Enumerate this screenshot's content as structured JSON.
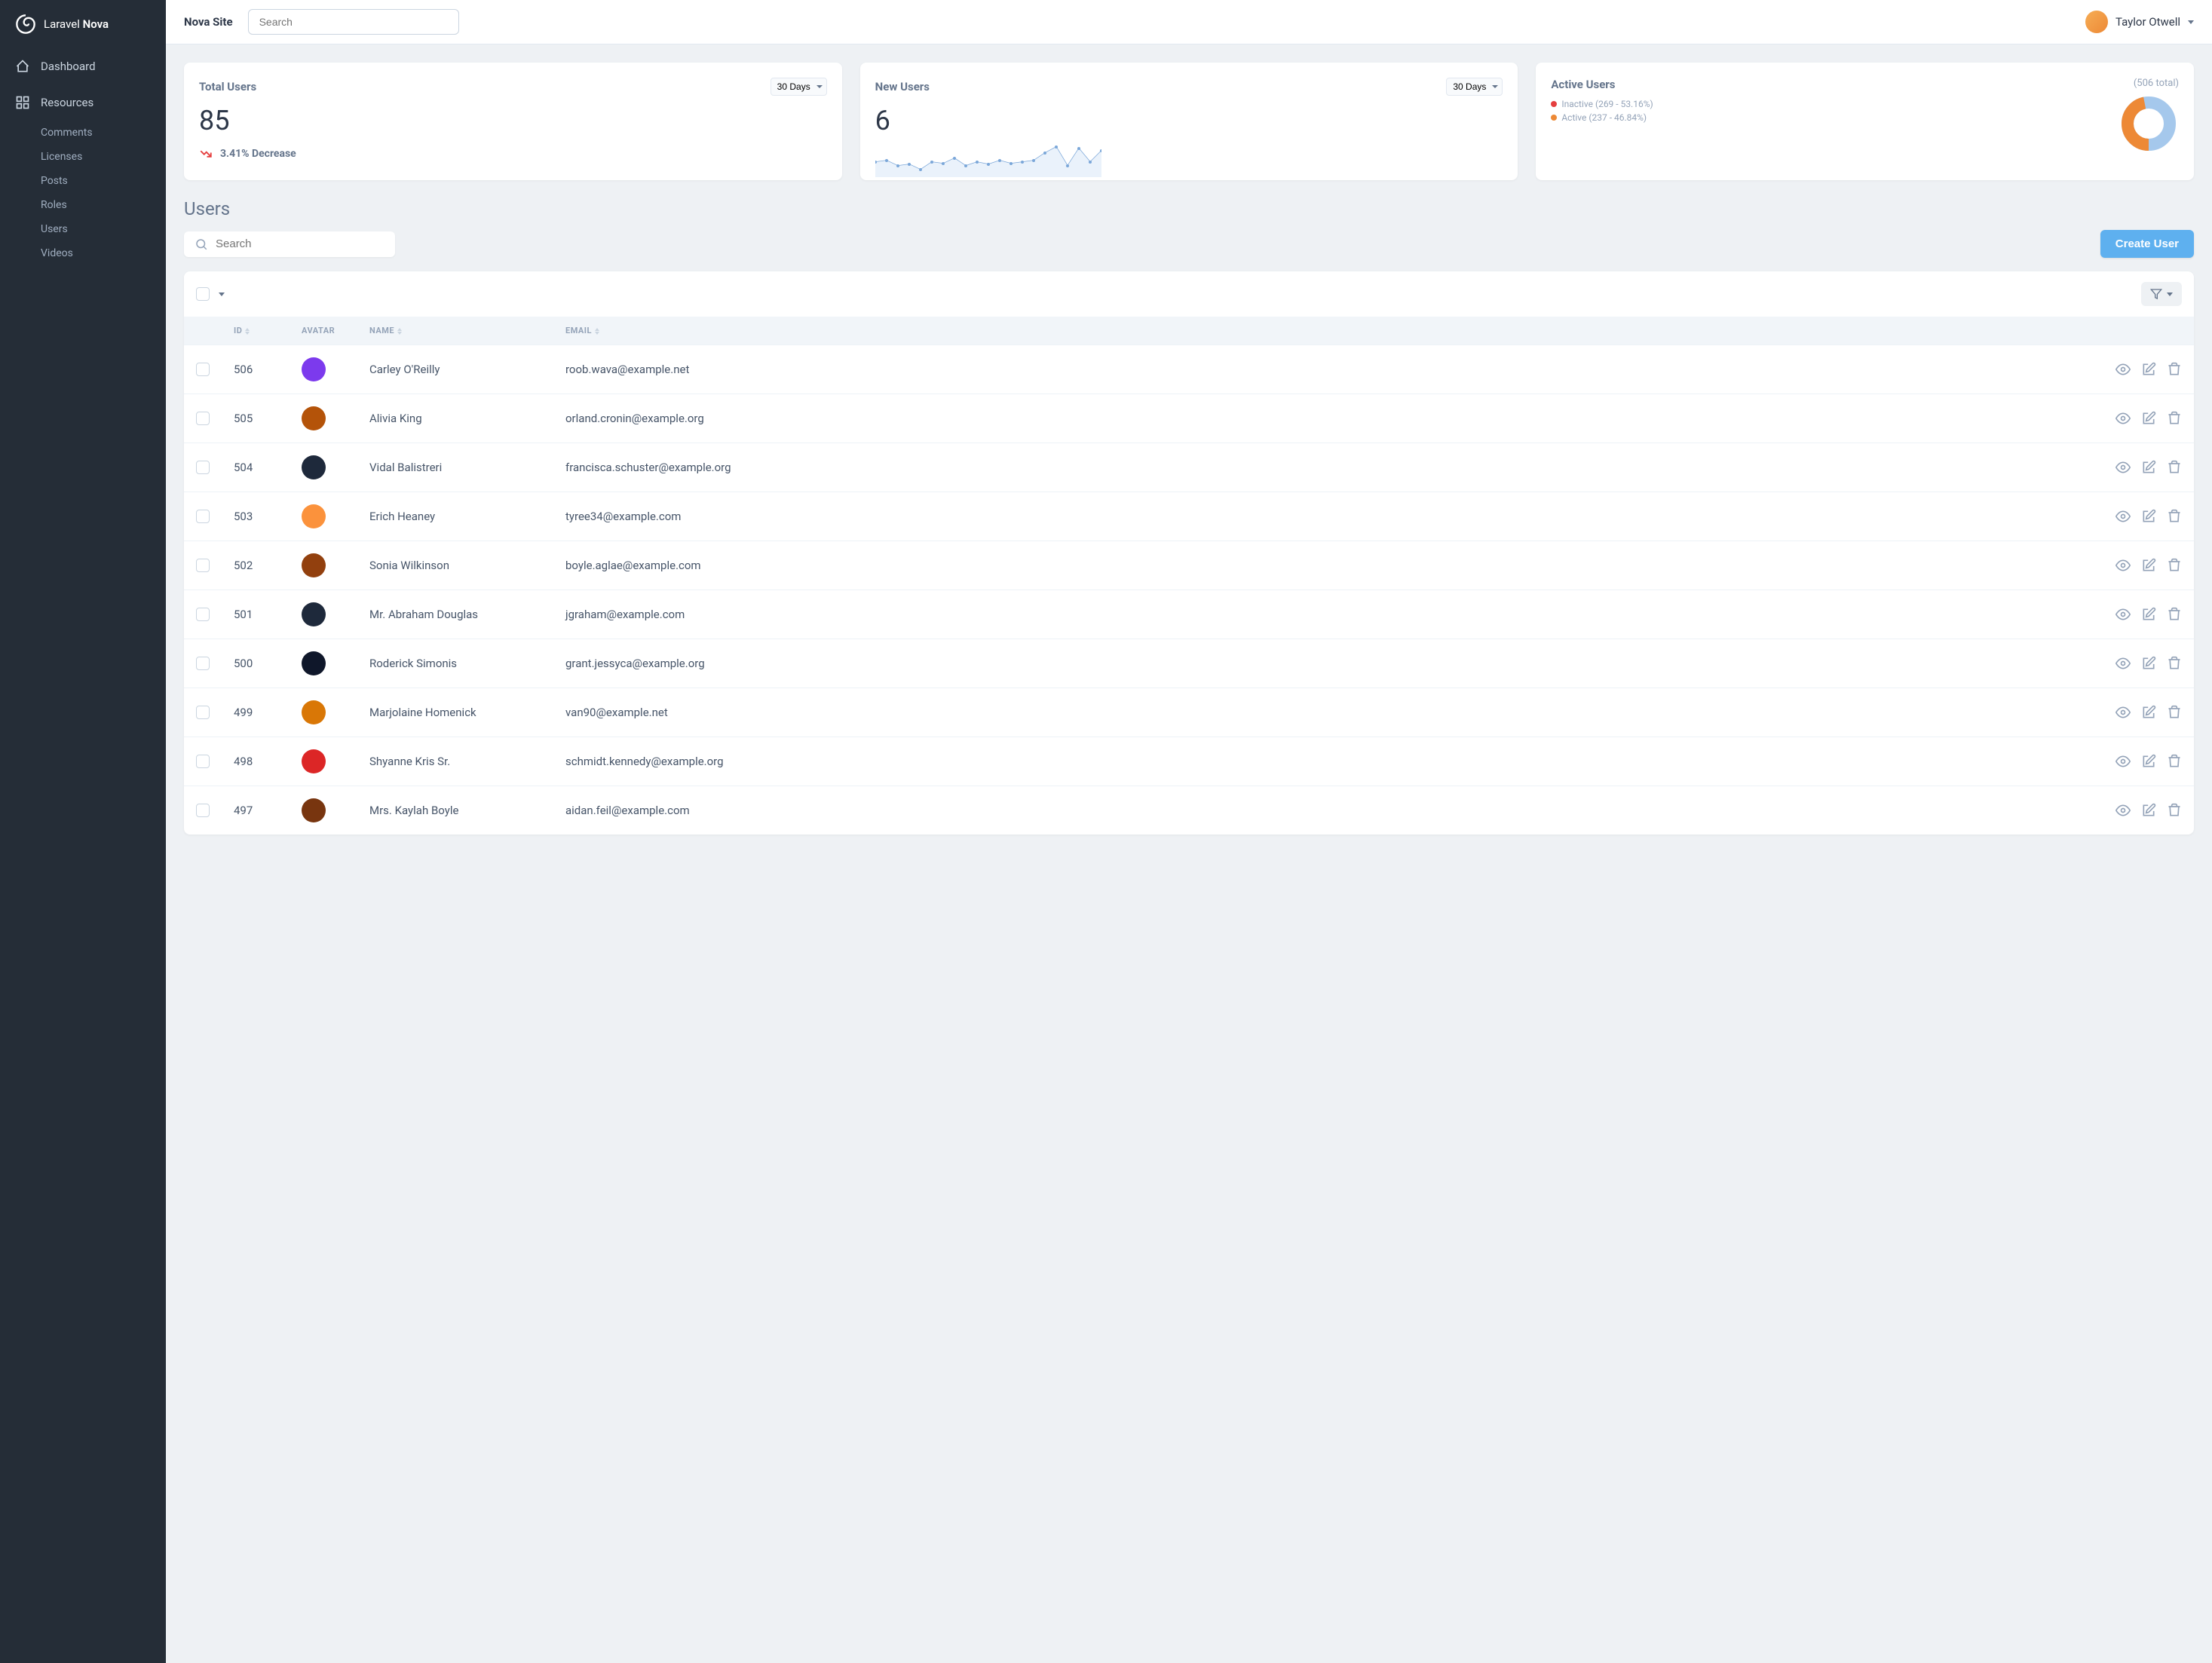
{
  "brand": {
    "name1": "Laravel",
    "name2": "Nova"
  },
  "topbar": {
    "site_name": "Nova Site",
    "search_placeholder": "Search",
    "user_name": "Taylor Otwell"
  },
  "sidebar": {
    "dashboard": "Dashboard",
    "resources": "Resources",
    "items": [
      "Comments",
      "Licenses",
      "Posts",
      "Roles",
      "Users",
      "Videos"
    ]
  },
  "cards": {
    "total_users": {
      "title": "Total Users",
      "range": "30 Days",
      "value": "85",
      "trend": "3.41% Decrease"
    },
    "new_users": {
      "title": "New Users",
      "range": "30 Days",
      "value": "6"
    },
    "active_users": {
      "title": "Active Users",
      "total": "(506 total)",
      "legend": [
        {
          "color": "#e53e3e",
          "label": "Inactive (269 - 53.16%)"
        },
        {
          "color": "#ed8936",
          "label": "Active (237 - 46.84%)"
        }
      ]
    }
  },
  "chart_data": {
    "type": "pie",
    "title": "Active Users",
    "total": 506,
    "series": [
      {
        "name": "Inactive",
        "value": 269,
        "pct": 53.16,
        "color": "#a5c8ec"
      },
      {
        "name": "Active",
        "value": 237,
        "pct": 46.84,
        "color": "#ed8936"
      }
    ]
  },
  "users_section": {
    "title": "Users",
    "search_placeholder": "Search",
    "create_label": "Create User",
    "columns": {
      "id": "ID",
      "avatar": "AVATAR",
      "name": "NAME",
      "email": "EMAIL"
    },
    "rows": [
      {
        "id": "506",
        "name": "Carley O'Reilly",
        "email": "roob.wava@example.net",
        "color": "#7c3aed"
      },
      {
        "id": "505",
        "name": "Alivia King",
        "email": "orland.cronin@example.org",
        "color": "#b45309"
      },
      {
        "id": "504",
        "name": "Vidal Balistreri",
        "email": "francisca.schuster@example.org",
        "color": "#1e293b"
      },
      {
        "id": "503",
        "name": "Erich Heaney",
        "email": "tyree34@example.com",
        "color": "#fb923c"
      },
      {
        "id": "502",
        "name": "Sonia Wilkinson",
        "email": "boyle.aglae@example.com",
        "color": "#92400e"
      },
      {
        "id": "501",
        "name": "Mr. Abraham Douglas",
        "email": "jgraham@example.com",
        "color": "#1e293b"
      },
      {
        "id": "500",
        "name": "Roderick Simonis",
        "email": "grant.jessyca@example.org",
        "color": "#0f172a"
      },
      {
        "id": "499",
        "name": "Marjolaine Homenick",
        "email": "van90@example.net",
        "color": "#d97706"
      },
      {
        "id": "498",
        "name": "Shyanne Kris Sr.",
        "email": "schmidt.kennedy@example.org",
        "color": "#dc2626"
      },
      {
        "id": "497",
        "name": "Mrs. Kaylah Boyle",
        "email": "aidan.feil@example.com",
        "color": "#78350f"
      }
    ]
  }
}
